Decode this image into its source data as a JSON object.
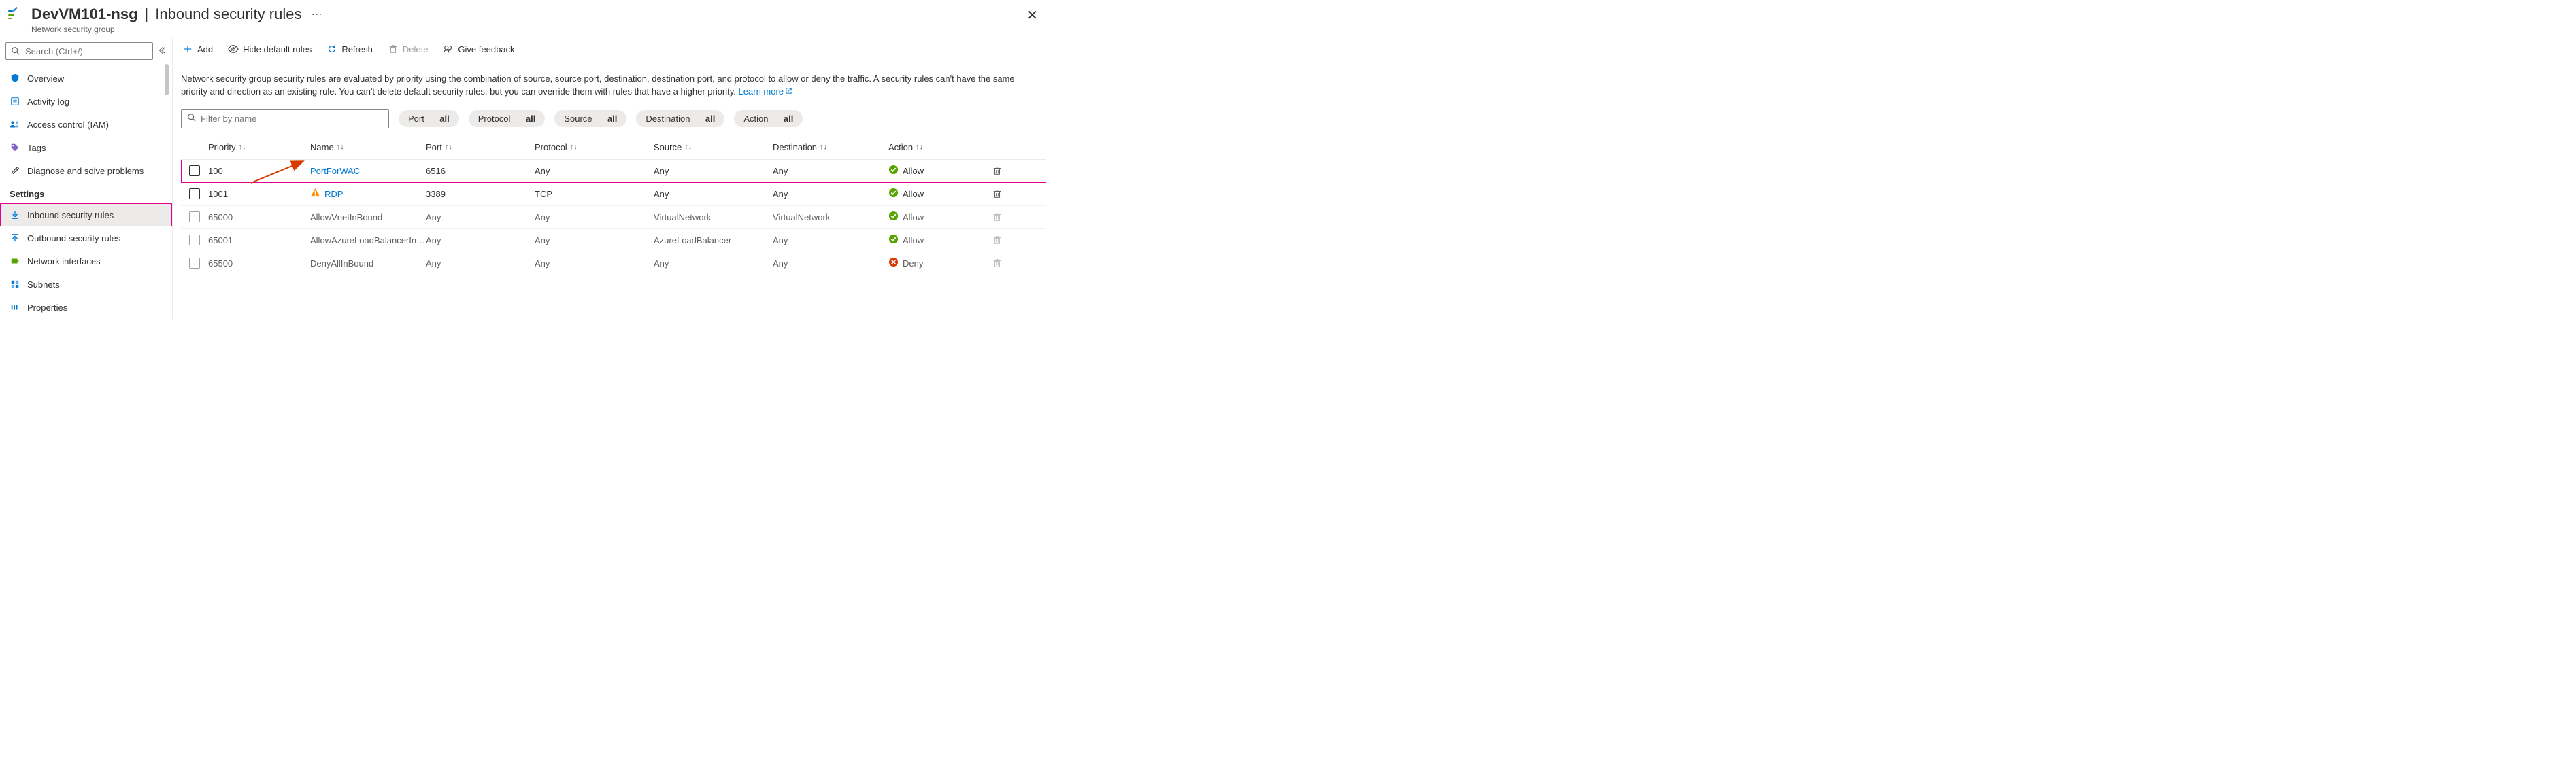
{
  "header": {
    "title_main": "DevVM101-nsg",
    "title_sub": "Inbound security rules",
    "subtitle": "Network security group"
  },
  "sidebar": {
    "search_placeholder": "Search (Ctrl+/)",
    "items": [
      {
        "label": "Overview"
      },
      {
        "label": "Activity log"
      },
      {
        "label": "Access control (IAM)"
      },
      {
        "label": "Tags"
      },
      {
        "label": "Diagnose and solve problems"
      }
    ],
    "settings_heading": "Settings",
    "settings_items": [
      {
        "label": "Inbound security rules",
        "active": true
      },
      {
        "label": "Outbound security rules"
      },
      {
        "label": "Network interfaces"
      },
      {
        "label": "Subnets"
      },
      {
        "label": "Properties"
      }
    ]
  },
  "toolbar": {
    "add": "Add",
    "hide": "Hide default rules",
    "refresh": "Refresh",
    "delete": "Delete",
    "feedback": "Give feedback"
  },
  "description": {
    "text": "Network security group security rules are evaluated by priority using the combination of source, source port, destination, destination port, and protocol to allow or deny the traffic. A security rules can't have the same priority and direction as an existing rule. You can't delete default security rules, but you can override them with rules that have a higher priority.",
    "learn_more": "Learn more"
  },
  "filters": {
    "filter_placeholder": "Filter by name",
    "pills": [
      {
        "key": "Port",
        "value": "all"
      },
      {
        "key": "Protocol",
        "value": "all"
      },
      {
        "key": "Source",
        "value": "all"
      },
      {
        "key": "Destination",
        "value": "all"
      },
      {
        "key": "Action",
        "value": "all"
      }
    ]
  },
  "columns": {
    "priority": "Priority",
    "name": "Name",
    "port": "Port",
    "protocol": "Protocol",
    "source": "Source",
    "destination": "Destination",
    "action": "Action"
  },
  "rows": [
    {
      "priority": "100",
      "name": "PortForWAC",
      "port": "6516",
      "protocol": "Any",
      "source": "Any",
      "destination": "Any",
      "action": "Allow",
      "link": true,
      "warn": false,
      "default": false,
      "highlighted": true
    },
    {
      "priority": "1001",
      "name": "RDP",
      "port": "3389",
      "protocol": "TCP",
      "source": "Any",
      "destination": "Any",
      "action": "Allow",
      "link": true,
      "warn": true,
      "default": false,
      "highlighted": false
    },
    {
      "priority": "65000",
      "name": "AllowVnetInBound",
      "port": "Any",
      "protocol": "Any",
      "source": "VirtualNetwork",
      "destination": "VirtualNetwork",
      "action": "Allow",
      "link": false,
      "warn": false,
      "default": true,
      "highlighted": false
    },
    {
      "priority": "65001",
      "name": "AllowAzureLoadBalancerInBound",
      "port": "Any",
      "protocol": "Any",
      "source": "AzureLoadBalancer",
      "destination": "Any",
      "action": "Allow",
      "link": false,
      "warn": false,
      "default": true,
      "highlighted": false
    },
    {
      "priority": "65500",
      "name": "DenyAllInBound",
      "port": "Any",
      "protocol": "Any",
      "source": "Any",
      "destination": "Any",
      "action": "Deny",
      "link": false,
      "warn": false,
      "default": true,
      "highlighted": false
    }
  ]
}
